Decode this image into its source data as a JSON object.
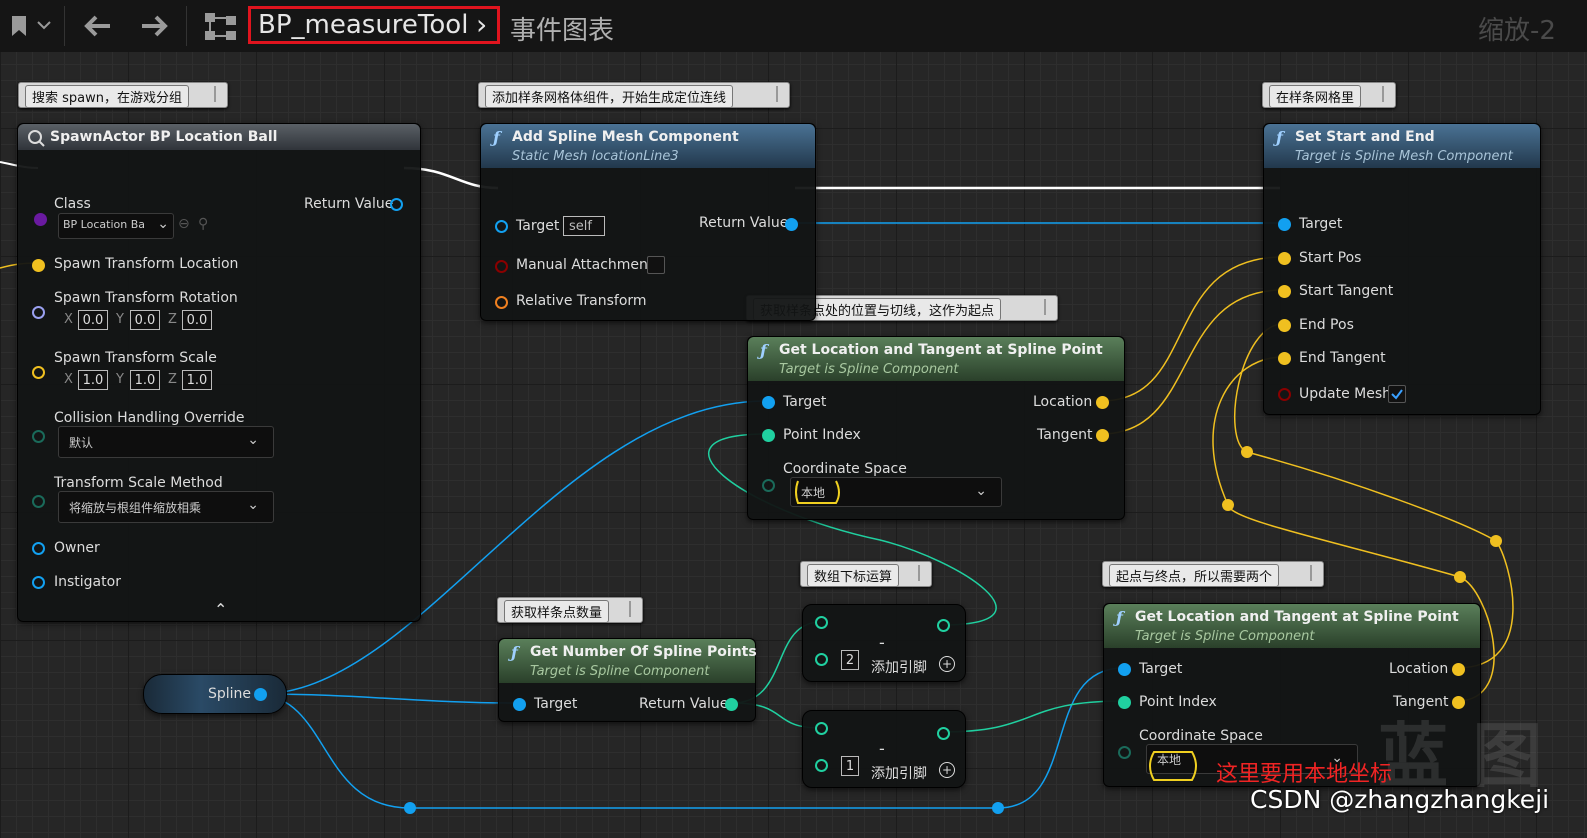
{
  "toolbar": {
    "blueprint_name": "BP_measureTool",
    "graph_name": "事件图表",
    "zoom_label": "缩放-2"
  },
  "comments": {
    "spawn": "搜索 spawn，在游戏分组",
    "add_spline": "添加样条网格体组件，开始生成定位连线",
    "in_spline": "在样条网格里",
    "get_loc_start": "获取样条点处的位置与切线，这作为起点",
    "get_count": "获取样条点数量",
    "index_math": "数组下标运算",
    "start_end": "起点与终点，所以需要两个"
  },
  "spawn_node": {
    "title": "SpawnActor BP Location Ball",
    "class_label": "Class",
    "class_value": "BP Location Ba",
    "return_value": "Return Value",
    "spawn_location": "Spawn Transform Location",
    "spawn_rotation": "Spawn Transform Rotation",
    "spawn_scale": "Spawn Transform Scale",
    "rot": {
      "x": "0.0",
      "y": "0.0",
      "z": "0.0"
    },
    "scale": {
      "x": "1.0",
      "y": "1.0",
      "z": "1.0"
    },
    "axis_x": "X",
    "axis_y": "Y",
    "axis_z": "Z",
    "collision_label": "Collision Handling Override",
    "collision_value": "默认",
    "scale_method_label": "Transform Scale Method",
    "scale_method_value": "将缩放与根组件缩放相乘",
    "owner": "Owner",
    "instigator": "Instigator"
  },
  "add_spline_node": {
    "title": "Add Spline Mesh Component",
    "subtitle": "Static Mesh locationLine3",
    "target": "Target",
    "target_value": "self",
    "return_value": "Return Value",
    "manual_attachment": "Manual Attachment",
    "relative_transform": "Relative Transform"
  },
  "set_start_end_node": {
    "title": "Set Start and End",
    "subtitle": "Target is Spline Mesh Component",
    "target": "Target",
    "start_pos": "Start Pos",
    "start_tangent": "Start Tangent",
    "end_pos": "End Pos",
    "end_tangent": "End Tangent",
    "update_mesh": "Update Mesh",
    "update_mesh_checked": true
  },
  "get_loc1_node": {
    "title": "Get Location and Tangent at Spline Point",
    "subtitle": "Target is Spline Component",
    "target": "Target",
    "point_index": "Point Index",
    "coord_space": "Coordinate Space",
    "coord_value": "本地",
    "location": "Location",
    "tangent": "Tangent"
  },
  "get_loc2_node": {
    "title": "Get Location and Tangent at Spline Point",
    "subtitle": "Target is Spline Component",
    "target": "Target",
    "point_index": "Point Index",
    "coord_space": "Coordinate Space",
    "coord_value": "本地",
    "location": "Location",
    "tangent": "Tangent"
  },
  "get_count_node": {
    "title": "Get Number Of Spline Points",
    "subtitle": "Target is Spline Component",
    "target": "Target",
    "return_value": "Return Value"
  },
  "spline_var": {
    "label": "Spline"
  },
  "minus1": {
    "op": "-",
    "value": "2",
    "add_pin": "添加引脚"
  },
  "minus2": {
    "op": "-",
    "value": "1",
    "add_pin": "添加引脚"
  },
  "annotation": "这里要用本地坐标",
  "watermark": "CSDN @zhangzhangkeji",
  "big_watermark": "蓝 图",
  "colors": {
    "exec": "#ffffff",
    "object": "#12a0f0",
    "vector": "#f0c020",
    "int": "#20d0a0",
    "struct": "#f08020",
    "bool": "#8a0000",
    "class": "#6a1aa0",
    "highlight": "#e0141e"
  },
  "icons": [
    "bookmark-icon",
    "chevron-down-icon",
    "back-arrow-icon",
    "forward-arrow-icon",
    "graph-hierarchy-icon",
    "function-icon",
    "spawn-icon",
    "checkmark-icon",
    "add-pin-icon",
    "collapse-icon"
  ]
}
